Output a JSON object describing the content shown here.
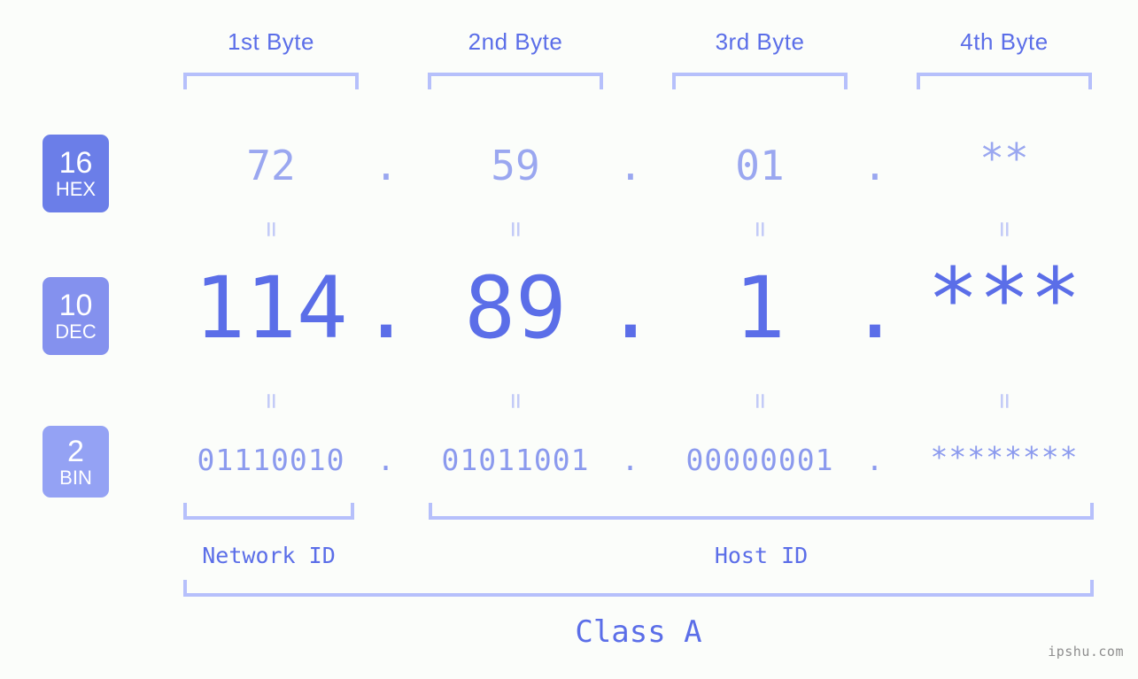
{
  "page": {
    "background_color": "#fbfdfa",
    "accent_color": "#5b6ee8",
    "bracket_color": "#b6c0fb",
    "watermark": "ipshu.com"
  },
  "byte_headers": [
    {
      "label": "1st Byte"
    },
    {
      "label": "2nd Byte"
    },
    {
      "label": "3rd Byte"
    },
    {
      "label": "4th Byte"
    }
  ],
  "bases": [
    {
      "number": "16",
      "name": "HEX",
      "color": "#6b7ee8"
    },
    {
      "number": "10",
      "name": "DEC",
      "color": "#8491ee"
    },
    {
      "number": "2",
      "name": "BIN",
      "color": "#94a2f4"
    }
  ],
  "rows": {
    "hex": {
      "base_number": "16",
      "base_name": "HEX",
      "values": [
        "72",
        "59",
        "01",
        "**"
      ],
      "separator": "."
    },
    "dec": {
      "base_number": "10",
      "base_name": "DEC",
      "values": [
        "114",
        "89",
        "1",
        "***"
      ],
      "separator": "."
    },
    "bin": {
      "base_number": "2",
      "base_name": "BIN",
      "values": [
        "01110010",
        "01011001",
        "00000001",
        "********"
      ],
      "separator": "."
    }
  },
  "equals_marks": {
    "glyph": "=",
    "count_per_row": 4
  },
  "sections": {
    "network_id": "Network ID",
    "host_id": "Host ID",
    "ip_class": "Class A"
  }
}
